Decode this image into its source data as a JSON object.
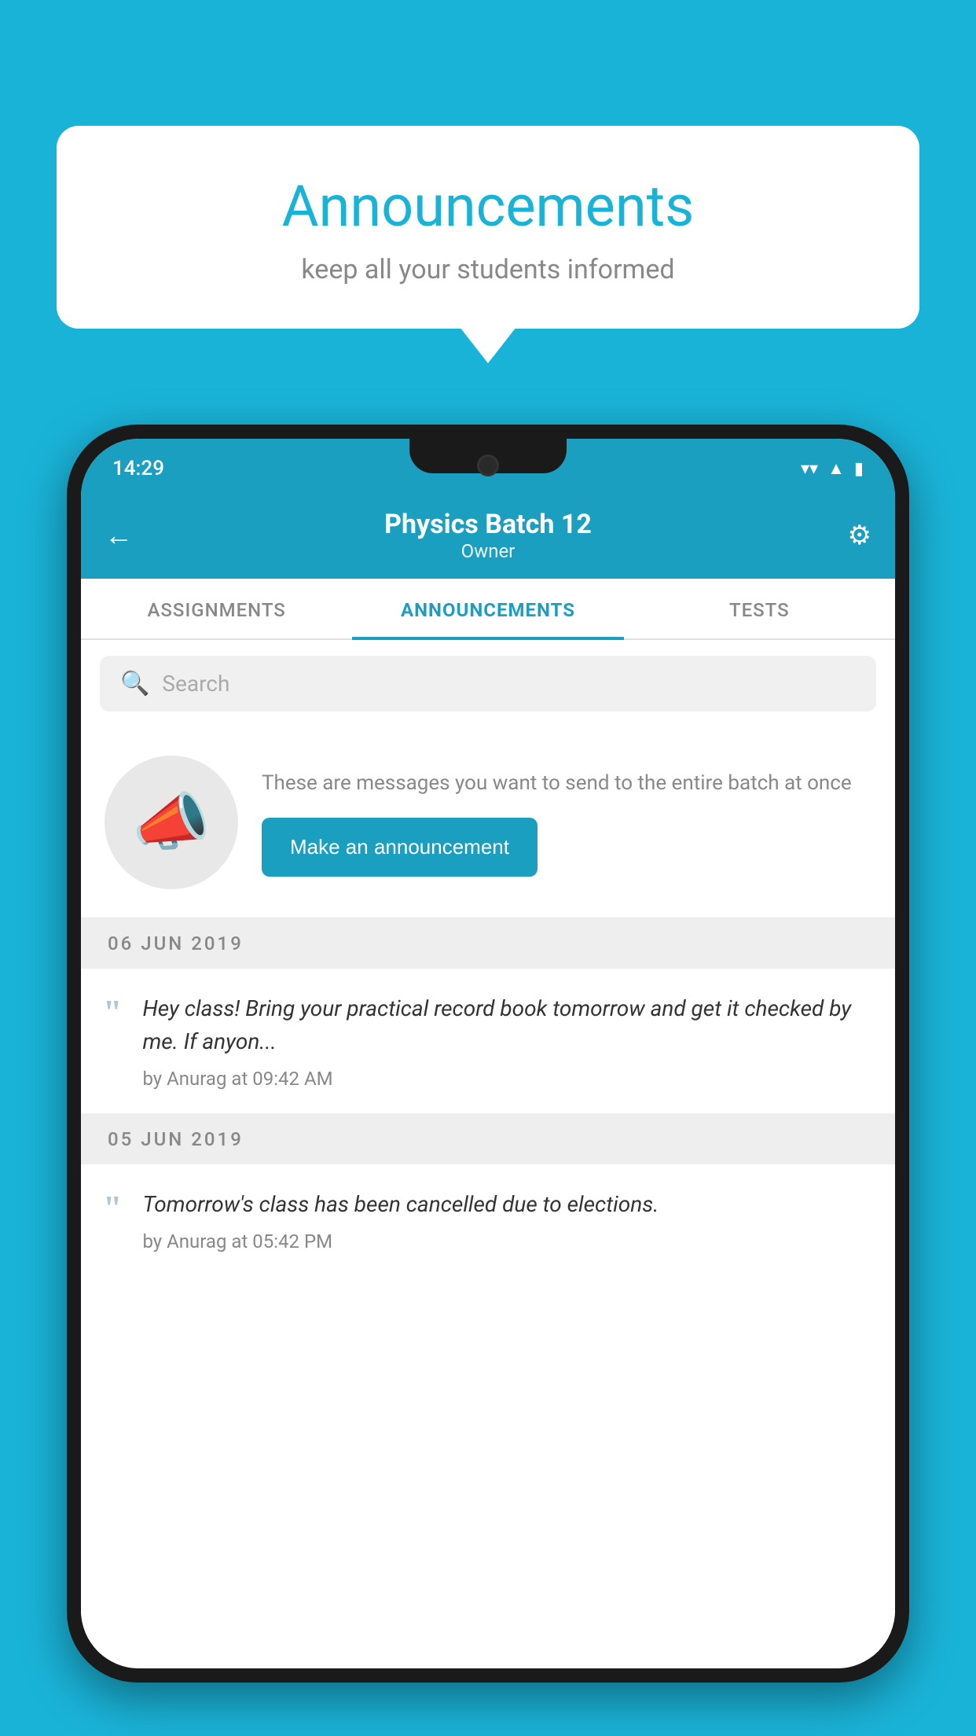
{
  "background_color": "#1ab3d8",
  "bubble": {
    "title": "Announcements",
    "subtitle": "keep all your students informed"
  },
  "status_bar": {
    "time": "14:29",
    "icons": [
      "wifi",
      "signal",
      "battery"
    ]
  },
  "header": {
    "title": "Physics Batch 12",
    "subtitle": "Owner",
    "back_label": "←",
    "settings_label": "⚙"
  },
  "tabs": [
    {
      "label": "ASSIGNMENTS",
      "active": false
    },
    {
      "label": "ANNOUNCEMENTS",
      "active": true
    },
    {
      "label": "TESTS",
      "active": false
    },
    {
      "label": "...",
      "active": false
    }
  ],
  "search": {
    "placeholder": "Search"
  },
  "announcement_prompt": {
    "description": "These are messages you want to send to the entire batch at once",
    "button_label": "Make an announcement"
  },
  "announcements": [
    {
      "date": "06  JUN  2019",
      "body": "Hey class! Bring your practical record book tomorrow and get it checked by me. If anyon...",
      "meta": "by Anurag at 09:42 AM"
    },
    {
      "date": "05  JUN  2019",
      "body": "Tomorrow's class has been cancelled due to elections.",
      "meta": "by Anurag at 05:42 PM"
    }
  ]
}
